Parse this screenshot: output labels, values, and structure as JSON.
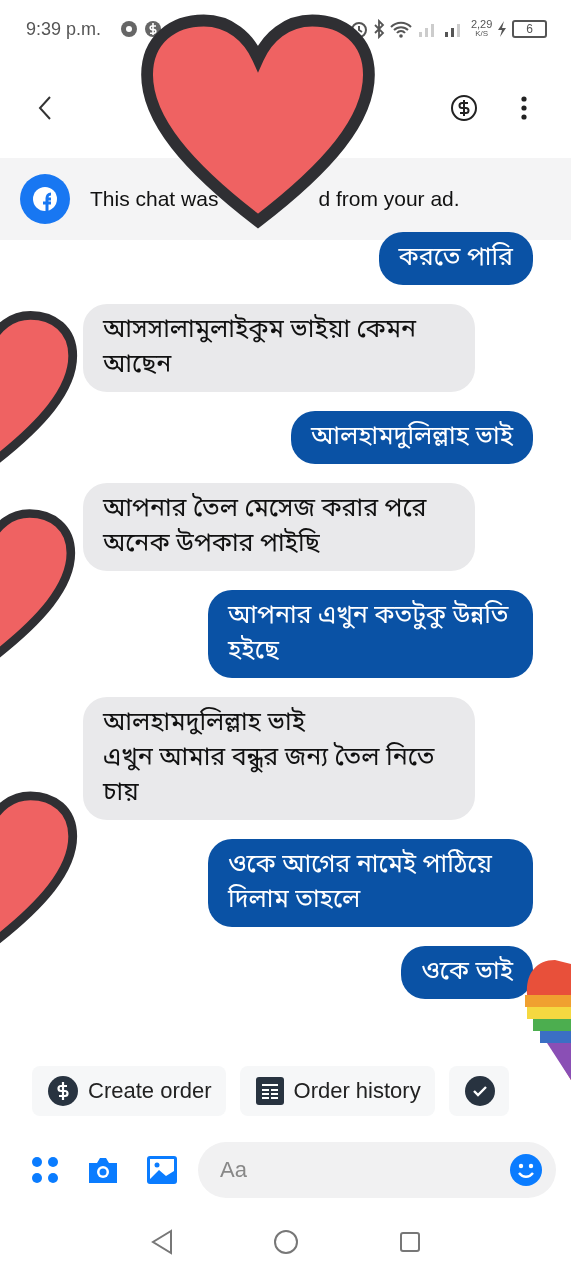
{
  "status_bar": {
    "time": "9:39 p.m.",
    "speed": "2,29",
    "speed_unit": "K/S",
    "battery": "6"
  },
  "banner": {
    "text_before": "This chat was",
    "text_after": "d from your ad."
  },
  "messages": [
    {
      "kind": "sent",
      "text": "করতে পারি"
    },
    {
      "kind": "received",
      "text": "আসসালামুলাইকুম  ভাইয়া কেমন আছেন"
    },
    {
      "kind": "sent",
      "text": "আলহামদুলিল্লাহ  ভাই"
    },
    {
      "kind": "received",
      "text": "আপনার তৈল মেসেজ করার পরে অনেক উপকার পাইছি"
    },
    {
      "kind": "sent",
      "text": "আপনার এখুন কতটুকু উন্নতি হইছে"
    },
    {
      "kind": "received",
      "text": "আলহামদুলিল্লাহ ভাই\nএখুন আমার বন্ধুর জন্য তৈল নিতে চায়"
    },
    {
      "kind": "sent",
      "text": "ওকে আগের নামেই পাঠিয়ে দিলাম তাহলে"
    },
    {
      "kind": "sent",
      "text": "ওকে ভাই"
    }
  ],
  "quick_replies": [
    {
      "kind": "dollar",
      "label": "Create order"
    },
    {
      "kind": "list",
      "label": "Order history"
    },
    {
      "kind": "check"
    }
  ],
  "composer": {
    "placeholder": "Aa"
  }
}
